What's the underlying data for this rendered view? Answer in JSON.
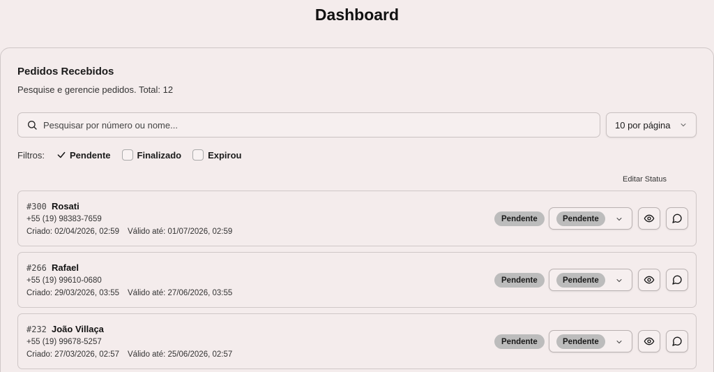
{
  "page": {
    "title": "Dashboard"
  },
  "orders_card": {
    "title": "Pedidos Recebidos",
    "subtitle": "Pesquise e gerencie pedidos. Total: 12",
    "search_placeholder": "Pesquisar por número ou nome...",
    "per_page": "10 por página",
    "filters_label": "Filtros:",
    "filters": [
      {
        "label": "Pendente",
        "checked": true
      },
      {
        "label": "Finalizado",
        "checked": false
      },
      {
        "label": "Expirou",
        "checked": false
      }
    ],
    "edit_status_label": "Editar Status"
  },
  "orders": [
    {
      "number": "#300",
      "name": "Rosati",
      "phone": "+55 (19) 98383-7659",
      "created": "Criado: 02/04/2026, 02:59",
      "valid": "Válido até: 01/07/2026, 02:59",
      "status_badge": "Pendente",
      "status_select": "Pendente"
    },
    {
      "number": "#266",
      "name": "Rafael",
      "phone": "+55 (19) 99610-0680",
      "created": "Criado: 29/03/2026, 03:55",
      "valid": "Válido até: 27/06/2026, 03:55",
      "status_badge": "Pendente",
      "status_select": "Pendente"
    },
    {
      "number": "#232",
      "name": "João Villaça",
      "phone": "+55 (19) 99678-5257",
      "created": "Criado: 27/03/2026, 02:57",
      "valid": "Válido até: 25/06/2026, 02:57",
      "status_badge": "Pendente",
      "status_select": "Pendente"
    }
  ],
  "icons": {
    "search": "search-icon",
    "chevron": "chevron-down-icon",
    "view": "eye-icon",
    "message": "message-circle-icon",
    "check": "check-icon"
  }
}
